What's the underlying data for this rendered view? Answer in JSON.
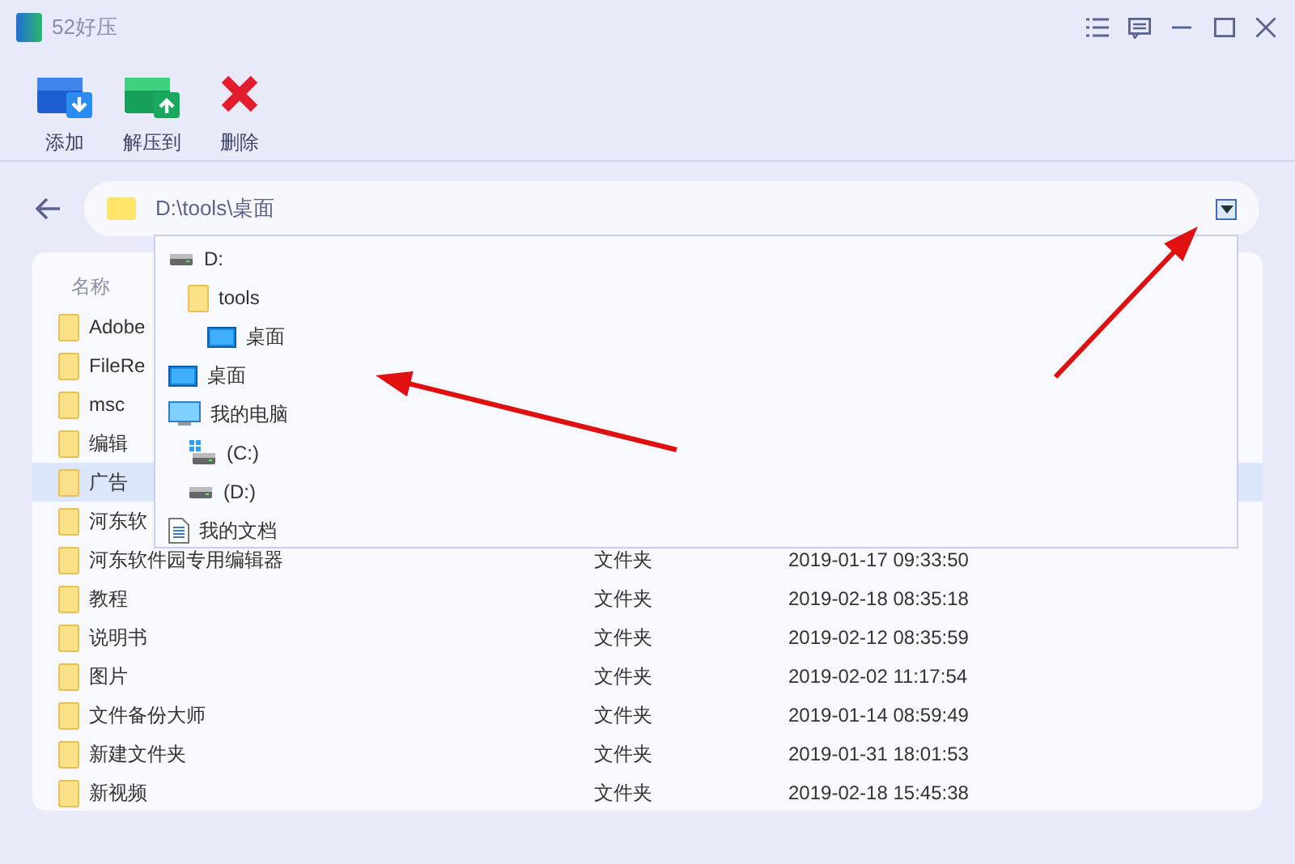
{
  "window": {
    "title": "52好压"
  },
  "toolbar": [
    {
      "label": "添加",
      "kind": "add"
    },
    {
      "label": "解压到",
      "kind": "extract"
    },
    {
      "label": "删除",
      "kind": "delete"
    }
  ],
  "address_bar": {
    "path": "D:\\tools\\桌面",
    "dropdown_expanded": true
  },
  "location_dropdown": [
    {
      "label": "D:",
      "kind": "drive",
      "children": [
        {
          "label": "tools",
          "kind": "folder",
          "children": [
            {
              "label": "桌面",
              "kind": "desktop"
            }
          ]
        }
      ]
    },
    {
      "label": "桌面",
      "kind": "desktop"
    },
    {
      "label": "我的电脑",
      "kind": "computer",
      "children": [
        {
          "label": "(C:)",
          "kind": "system_drive"
        },
        {
          "label": "(D:)",
          "kind": "drive"
        }
      ]
    },
    {
      "label": "我的文档",
      "kind": "document"
    }
  ],
  "file_list": {
    "columns": [
      "名称"
    ],
    "rows": [
      {
        "name": "Adobe",
        "selected": false
      },
      {
        "name": "FileRe",
        "selected": false
      },
      {
        "name": "msc",
        "selected": false
      },
      {
        "name": "编辑",
        "selected": false
      },
      {
        "name": "广告",
        "selected": true
      },
      {
        "name": "河东软",
        "selected": false
      },
      {
        "name": "河东软件园专用编辑器",
        "type": "文件夹",
        "modified": "2019-01-17 09:33:50",
        "selected": false
      },
      {
        "name": "教程",
        "type": "文件夹",
        "modified": "2019-02-18 08:35:18",
        "selected": false
      },
      {
        "name": "说明书",
        "type": "文件夹",
        "modified": "2019-02-12 08:35:59",
        "selected": false
      },
      {
        "name": "图片",
        "type": "文件夹",
        "modified": "2019-02-02 11:17:54",
        "selected": false
      },
      {
        "name": "文件备份大师",
        "type": "文件夹",
        "modified": "2019-01-14 08:59:49",
        "selected": false
      },
      {
        "name": "新建文件夹",
        "type": "文件夹",
        "modified": "2019-01-31 18:01:53",
        "selected": false
      },
      {
        "name": "新视频",
        "type": "文件夹",
        "modified": "2019-02-18 15:45:38",
        "selected": false
      }
    ]
  }
}
